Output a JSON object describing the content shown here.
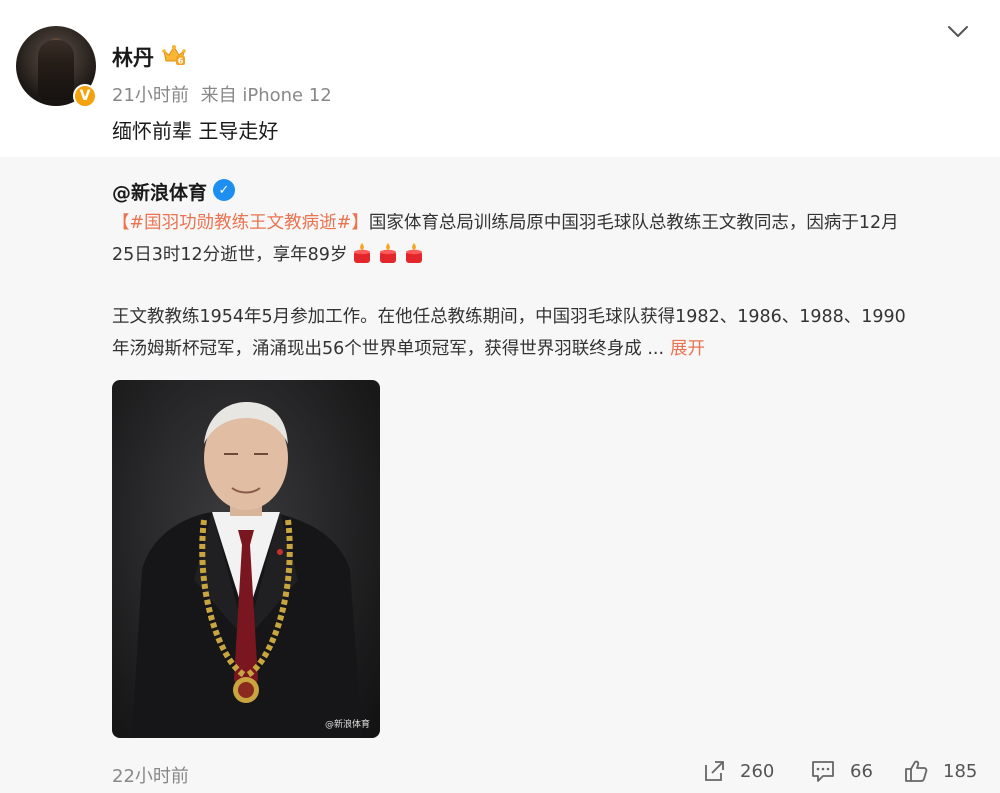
{
  "post": {
    "username": "林丹",
    "time": "21小时前",
    "source": "来自 iPhone 12",
    "text": "缅怀前辈 王导走好"
  },
  "repost": {
    "author": "@新浪体育",
    "bracket_open": "【",
    "hashtag": "#国羽功勋教练王文教病逝#",
    "bracket_close": "】",
    "line1_rest": "国家体育总局训练局原中国羽毛球队总教练王文教同志，因病于12月",
    "line2": "25日3时12分逝世，享年89岁",
    "para2_line1": "王文教教练1954年5月参加工作。在他任总教练期间，中国羽毛球队获得1982、1986、1988、1990",
    "para2_line2": "年汤姆斯杯冠军，涌涌现出56个世界单项冠军，获得世界羽联终身成  ...",
    "expand": "展开",
    "watermark": "@新浪体育",
    "time": "22小时前"
  },
  "actions": {
    "forward_count": "260",
    "comment_count": "66",
    "like_count": "185"
  },
  "icons": {
    "vip": "vip-crown-icon",
    "verify": "verified-badge-icon",
    "more": "chevron-down-icon",
    "candle": "candle-icon",
    "forward": "share-icon",
    "comment": "comment-icon",
    "like": "thumbs-up-icon"
  },
  "colors": {
    "accent": "#eb7350",
    "verify_gold": "#f4a20d",
    "verify_blue": "#1f8ef1",
    "repost_bg": "#f7f7f7"
  }
}
